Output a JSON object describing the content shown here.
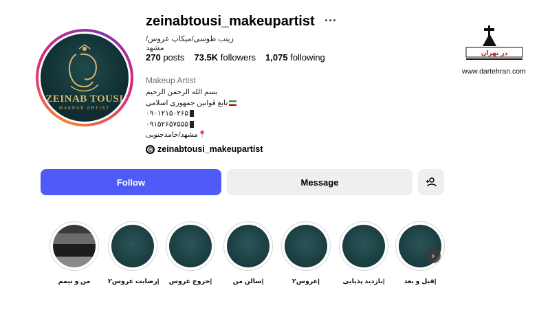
{
  "profile": {
    "username": "zeinabtousi_makeupartist",
    "more_glyph": "···",
    "display_name": "زینب طوسی/میکاپ عروس/مشهد",
    "avatar_title": "ZEINAB TOUSI",
    "avatar_subtitle": "MAKEUP ARTIST",
    "stats": {
      "posts_count": "270",
      "posts_label": "posts",
      "followers_count": "73.5K",
      "followers_label": "followers",
      "following_count": "1,075",
      "following_label": "following"
    },
    "category": "Makeup Artist",
    "bio": {
      "line1": "بسم الله الرحمن الرحیم",
      "line2": "تابع قوانین جمهوری اسلامی",
      "line3": "۰۹۰۱۲۱۵۰۲۶۵",
      "line4": "۰۹۱۵۲۶۵۷۵۵۵",
      "line5": "مشهد/حامدجنوبی"
    },
    "threads_handle": "zeinabtousi_makeupartist"
  },
  "actions": {
    "follow_label": "Follow",
    "message_label": "Message",
    "suggest_icon": "add-person-icon"
  },
  "highlights": [
    {
      "label": "من و تیمم",
      "type": "photo"
    },
    {
      "label": "رضایت عروس۲|",
      "type": "logo"
    },
    {
      "label": "خروج عروس|",
      "type": "logo"
    },
    {
      "label": "سالن من|",
      "type": "logo"
    },
    {
      "label": "عروس۲|",
      "type": "logo"
    },
    {
      "label": "بازدید پذیایی|",
      "type": "logo"
    },
    {
      "label": "قبل و بعد|",
      "type": "logo"
    }
  ],
  "watermark": {
    "logo_text": "در تهران",
    "url": "www.dartehran.com"
  },
  "colors": {
    "follow_button": "#4f5bf6",
    "secondary_button": "#efeff1",
    "avatar_bg": "#0f2c30",
    "gold": "#d8b56d"
  }
}
